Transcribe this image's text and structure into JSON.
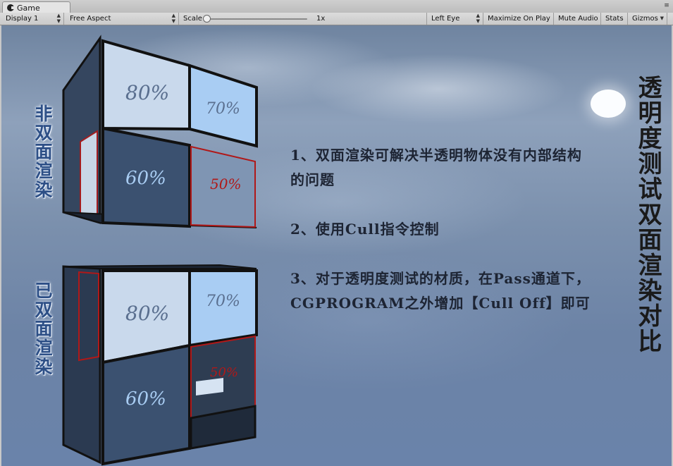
{
  "window": {
    "tab_title": "Game",
    "tab_icon": "game-controller-icon",
    "menu_icon": "tab-menu-icon"
  },
  "toolbar": {
    "display": "Display 1",
    "aspect": "Free Aspect",
    "scale_label": "Scale",
    "scale_value": "1x",
    "scale_level": 0.0,
    "eye": "Left Eye",
    "maximize_on_play": "Maximize On Play",
    "mute_audio": "Mute Audio",
    "stats": "Stats",
    "gizmos": "Gizmos"
  },
  "scene": {
    "label_top": "非双面渲染",
    "label_bottom": "已双面渲染",
    "title": "透明度测试双面渲染对比",
    "notes": [
      "1、双面渲染可解决半透明物体没有内部结构的问题",
      "2、使用Cull指令控制",
      "3、对于透明度测试的材质，在Pass通道下， CGPROGRAM之外增加【Cull Off】即可"
    ],
    "top_cube_faces": [
      "80%",
      "70%",
      "60%",
      "50%"
    ],
    "bottom_cube_faces": [
      "80%",
      "70%",
      "60%",
      "50%"
    ],
    "colors": {
      "light_face": "#c9d9ec",
      "blue_face": "#a9cdf3",
      "dark_face": "#3b5170",
      "frame": "#111111",
      "red_edge": "#b01818",
      "label_blue": "#2d4f86"
    }
  }
}
